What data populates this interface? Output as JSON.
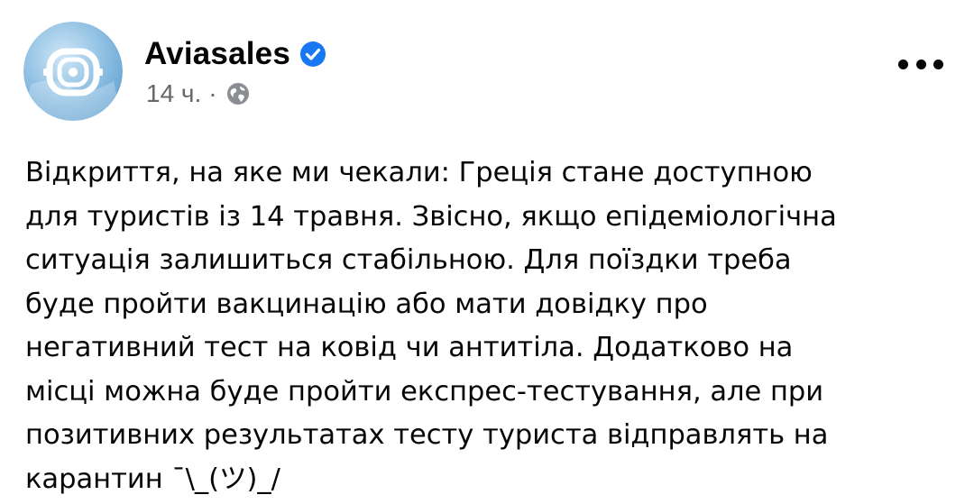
{
  "post": {
    "author": {
      "name": "Aviasales",
      "verified": true,
      "avatar_icon": "porthole-logo-icon"
    },
    "meta": {
      "timestamp": "14 ч.",
      "separator": "·",
      "privacy_icon": "globe-icon"
    },
    "menu_icon": "more-options-icon",
    "body_lines": [
      "Відкриття, на яке ми чекали: Греція стане доступною",
      "для туристів із 14 травня. Звісно, якщо епідеміологічна",
      "ситуація залишиться стабільною. Для поїздки треба",
      "буде пройти вакцинацію або мати довідку про",
      "негативний тест на ковід чи антитіла. Додатково на",
      "місці можна буде пройти експрес-тестування, але при",
      "позитивних результатах тесту туриста відправлять на",
      "карантин ¯\\_(ツ)_/"
    ]
  },
  "colors": {
    "verified_badge": "#1877f2",
    "secondary_text": "#65676b",
    "avatar_sky": "#7fb5dd"
  }
}
